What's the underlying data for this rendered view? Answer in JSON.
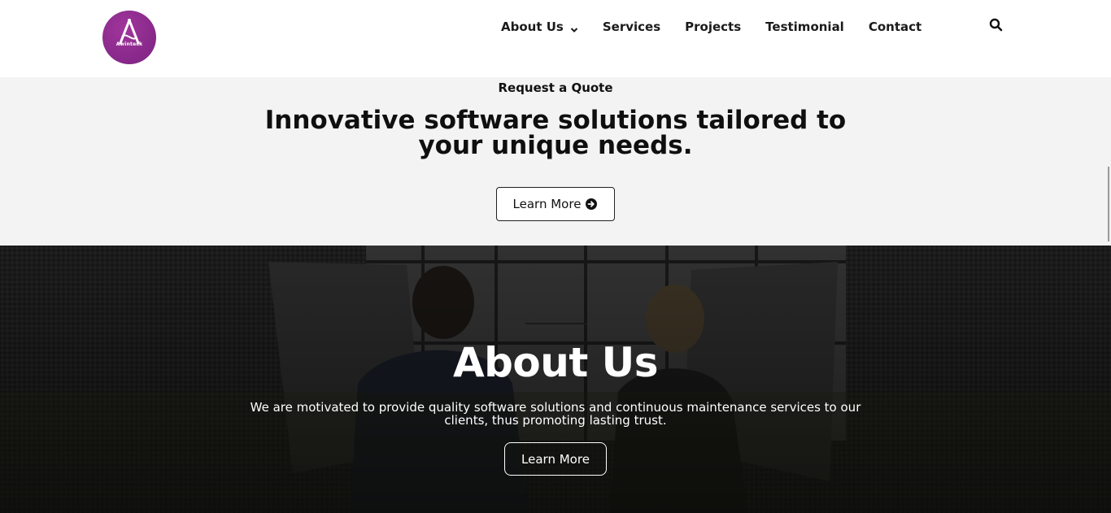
{
  "header": {
    "logo_text": "Awinteck",
    "nav": [
      {
        "label": "About Us",
        "has_dropdown": true
      },
      {
        "label": "Services"
      },
      {
        "label": "Projects"
      },
      {
        "label": "Testimonial"
      },
      {
        "label": "Contact"
      }
    ],
    "search_icon": "search-icon"
  },
  "hero": {
    "subtitle": "Request a Quote",
    "title": "Innovative software solutions tailored to your unique needs.",
    "button_label": "Learn More",
    "button_icon": "arrow-circle-right-icon",
    "background": "#f3f3f3"
  },
  "about": {
    "title": "About Us",
    "text": "We are motivated to provide quality software solutions and continuous maintenance services to our clients, thus promoting lasting trust.",
    "button_label": "Learn More"
  },
  "colors": {
    "brand": "#8a2a8c",
    "text": "#111111",
    "about_overlay": "#1a1a1a"
  }
}
